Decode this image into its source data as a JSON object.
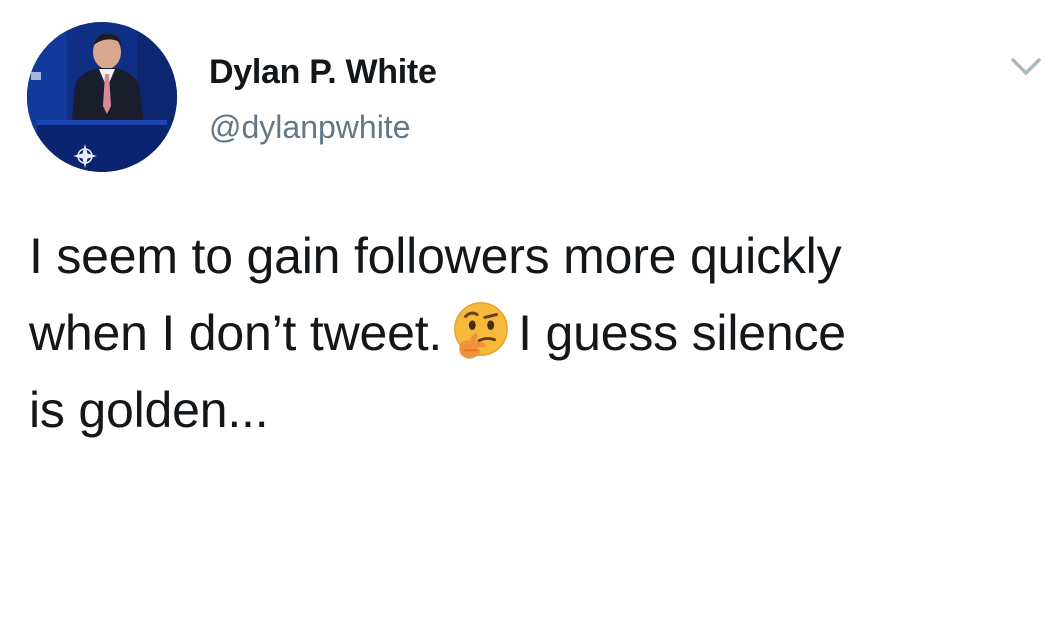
{
  "tweet": {
    "author": {
      "display_name": "Dylan P. White",
      "handle": "@dylanpwhite"
    },
    "text_lines": [
      "I seem to gain followers more quickly",
      "when I don’t tweet.",
      "I guess silence",
      "is golden..."
    ],
    "emoji": "thinking-face",
    "menu_icon": "chevron-down-icon"
  },
  "colors": {
    "text_primary": "#14171a",
    "text_secondary": "#657786",
    "caret": "#aab8c2",
    "background": "#ffffff"
  }
}
